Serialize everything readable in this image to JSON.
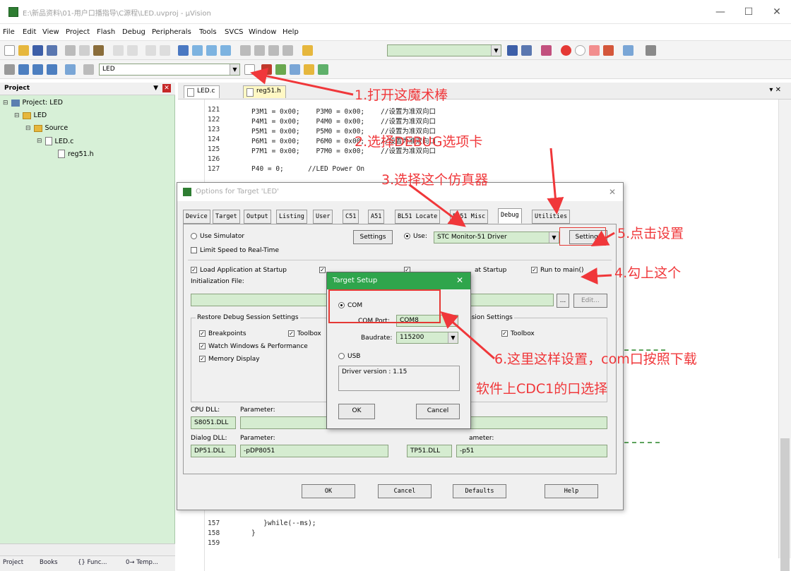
{
  "window": {
    "title": "E:\\新品资料\\01-用户口播指导\\C源程\\LED.uvproj - µVision",
    "minimize": "—",
    "maximize": "☐",
    "close": "✕"
  },
  "menu": [
    "File",
    "Edit",
    "View",
    "Project",
    "Flash",
    "Debug",
    "Peripherals",
    "Tools",
    "SVCS",
    "Window",
    "Help"
  ],
  "toolbar": {
    "target_combo": "LED"
  },
  "project_panel": {
    "title": "Project",
    "pin": "▼",
    "close": "✕",
    "tree": {
      "root": "Project: LED",
      "target": "LED",
      "group": "Source",
      "file1": "LED.c",
      "file2": "reg51.h"
    },
    "tabs": [
      "Project",
      "Books",
      "{} Func...",
      "0→ Temp..."
    ]
  },
  "editor": {
    "tabs": [
      "LED.c",
      "reg51.h"
    ],
    "lines": [
      {
        "n": "121",
        "code": "P3M1 = 0x00;    P3M0 = 0x00;    //设置为准双向口"
      },
      {
        "n": "122",
        "code": "P4M1 = 0x00;    P4M0 = 0x00;    //设置为准双向口"
      },
      {
        "n": "123",
        "code": "P5M1 = 0x00;    P5M0 = 0x00;    //设置为准双向口"
      },
      {
        "n": "124",
        "code": "P6M1 = 0x00;    P6M0 = 0x00;    //设置为准双向口"
      },
      {
        "n": "125",
        "code": "P7M1 = 0x00;    P7M0 = 0x00;    //设置为准双向口"
      },
      {
        "n": "126",
        "code": ""
      },
      {
        "n": "127",
        "code": "P40 = 0;      //LED Power On"
      }
    ],
    "bottom_lines": [
      {
        "n": "157",
        "code": "   }while(--ms);"
      },
      {
        "n": "158",
        "code": "}"
      },
      {
        "n": "159",
        "code": ""
      }
    ]
  },
  "options_dialog": {
    "title": "Options for Target 'LED'",
    "close": "✕",
    "tabs": [
      "Device",
      "Target",
      "Output",
      "Listing",
      "User",
      "C51",
      "A51",
      "BL51 Locate",
      "BL51 Misc",
      "Debug",
      "Utilities"
    ],
    "selected_tab": "Debug",
    "use_simulator": "Use Simulator",
    "limit_speed": "Limit Speed to Real-Time",
    "settings": "Settings",
    "use": "Use:",
    "driver": "STC Monitor-51 Driver",
    "load_app": "Load Application at Startup",
    "load_app_right": "at Startup",
    "run_to_main": "Run to main()",
    "init_file": "Initialization File:",
    "edit": "Edit...",
    "restore_group": "Restore Debug Session Settings",
    "restore_group_right": "ssion Settings",
    "breakpoints": "Breakpoints",
    "toolbox": "Toolbox",
    "watch": "Watch Windows & Performance",
    "memory": "Memory Display",
    "toolbox_right": "Toolbox",
    "cpu_dll": "CPU DLL:",
    "parameter": "Parameter:",
    "cpu_dll_val": "S8051.DLL",
    "dialog_dll": "Dialog DLL:",
    "dialog_dll_val": "DP51.DLL",
    "dialog_param_val": "-pDP8051",
    "dialog_dll_right": "TP51.DLL",
    "dialog_param_right": "-p51",
    "parameter_right": "ameter:",
    "ok": "OK",
    "cancel": "Cancel",
    "defaults": "Defaults",
    "help": "Help"
  },
  "target_setup": {
    "title": "Target Setup",
    "close": "✕",
    "com": "COM",
    "com_port_label": "COM Port:",
    "com_port": "COM8",
    "baudrate_label": "Baudrate:",
    "baudrate": "115200",
    "usb": "USB",
    "driver_version": "Driver version : 1.15",
    "ok": "OK",
    "cancel": "Cancel"
  },
  "annotations": {
    "a1": "1.打开这魔术棒",
    "a2": "2.选择DEBUG选项卡",
    "a3": "3.选择这个仿真器",
    "a4": "4.勾上这个",
    "a5": "5.点击设置",
    "a6_line1": "6.这里这样设置，com口按照下载",
    "a6_line2": "软件上CDC1的口选择",
    "color": "#f0373a"
  }
}
